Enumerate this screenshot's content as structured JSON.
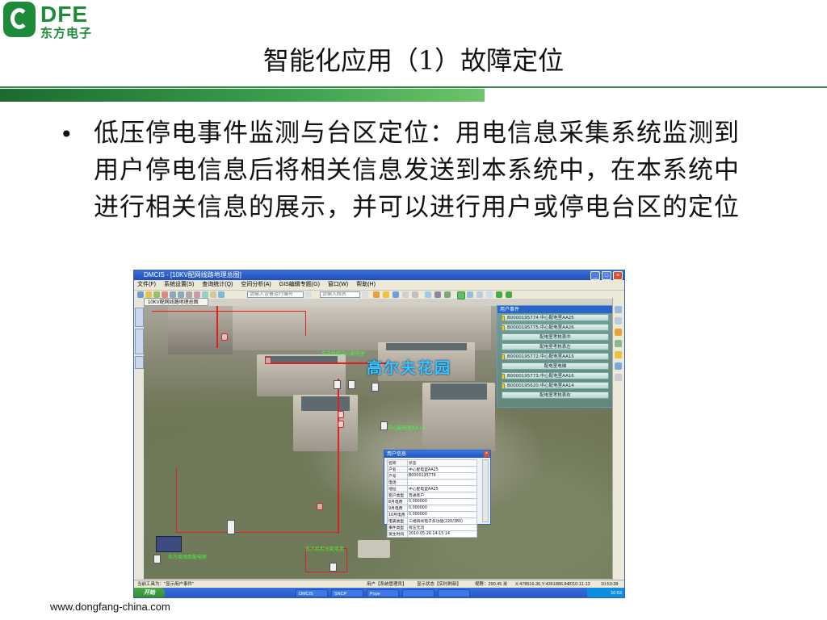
{
  "header": {
    "logo_text": "DFE",
    "logo_cn": "东方电子",
    "title": "智能化应用（1）故障定位"
  },
  "bullet": {
    "text": "低压停电事件监测与台区定位：用电信息采集系统监测到用户停电信息后将相关信息发送到本系统中，在本系统中进行相关信息的展示，并可以进行用户或停电台区的定位"
  },
  "footer": {
    "url": "www.dongfang-china.com"
  },
  "app": {
    "window_title": "DMCIS - [10KV配网线路地理总图]",
    "menus": [
      "文件(F)",
      "系统设置(S)",
      "查询统计(Q)",
      "空间分析(A)",
      "GIS编辑专题(G)",
      "窗口(W)",
      "帮助(H)"
    ],
    "toolbar": {
      "search_device": "请输入设备运行编号",
      "search_line": "请输入线名"
    },
    "map_tab": "10KV配网线路地理总图",
    "map": {
      "place_name": "高尔夫花园",
      "label_switch_top": "东方机柜中心配电室",
      "label_substation": "中心配电室AA14",
      "label_bottom": "东方机柜分配电室",
      "label_bottom_left": "东方商场新配电房"
    },
    "events_panel": {
      "title": "用户事件",
      "rows": [
        "B0000195774:中心配电室AA25",
        "B0000195775:中心配电室AA26",
        "配电室考核表中",
        "配电室考核表左",
        "B0000195772:中心配电室AA15",
        "配电室电梯",
        "B0000195773:中心配电室AA16",
        "B0000195620:中心配电室AA14",
        "配电室考核表右"
      ]
    },
    "user_info": {
      "title": "用户信息",
      "rows": [
        {
          "k": "名称",
          "v": "状态"
        },
        {
          "k": "户名",
          "v": "中心配电室AA25"
        },
        {
          "k": "户号",
          "v": "B0000195774"
        },
        {
          "k": "电话",
          "v": ""
        },
        {
          "k": "地址",
          "v": "中心配电室AA25"
        },
        {
          "k": "客户类型",
          "v": "普通客户"
        },
        {
          "k": "8月电费",
          "v": "0.000000"
        },
        {
          "k": "9月电费",
          "v": "0.000000"
        },
        {
          "k": "10月电费",
          "v": "0.000000"
        },
        {
          "k": "电表类型",
          "v": "三相四线电子多功能(220/380)"
        },
        {
          "k": "事件类型",
          "v": "有压无流"
        },
        {
          "k": "发生时间",
          "v": "2010-05-26 14:15:14"
        }
      ]
    },
    "statusbar": {
      "left": "当前工具为：\"显示用户事件\"",
      "user": "用户【系统管理员】",
      "state": "显示状态【实时刷新】",
      "view": "视野：290.45 米",
      "coords": "X:478516.36,Y:4361886.84",
      "date": "2010-11-13",
      "time": "10:53:38"
    },
    "taskbar": {
      "start": "开始",
      "tasks": [
        "DMCIS",
        "SNCP",
        "Pope",
        "",
        ""
      ],
      "clock": "10:53"
    },
    "colors": {
      "accent": "#2b64c8",
      "brand_green": "#1f8a3a",
      "redline": "#e02020",
      "map_label": "#33ccff"
    }
  }
}
